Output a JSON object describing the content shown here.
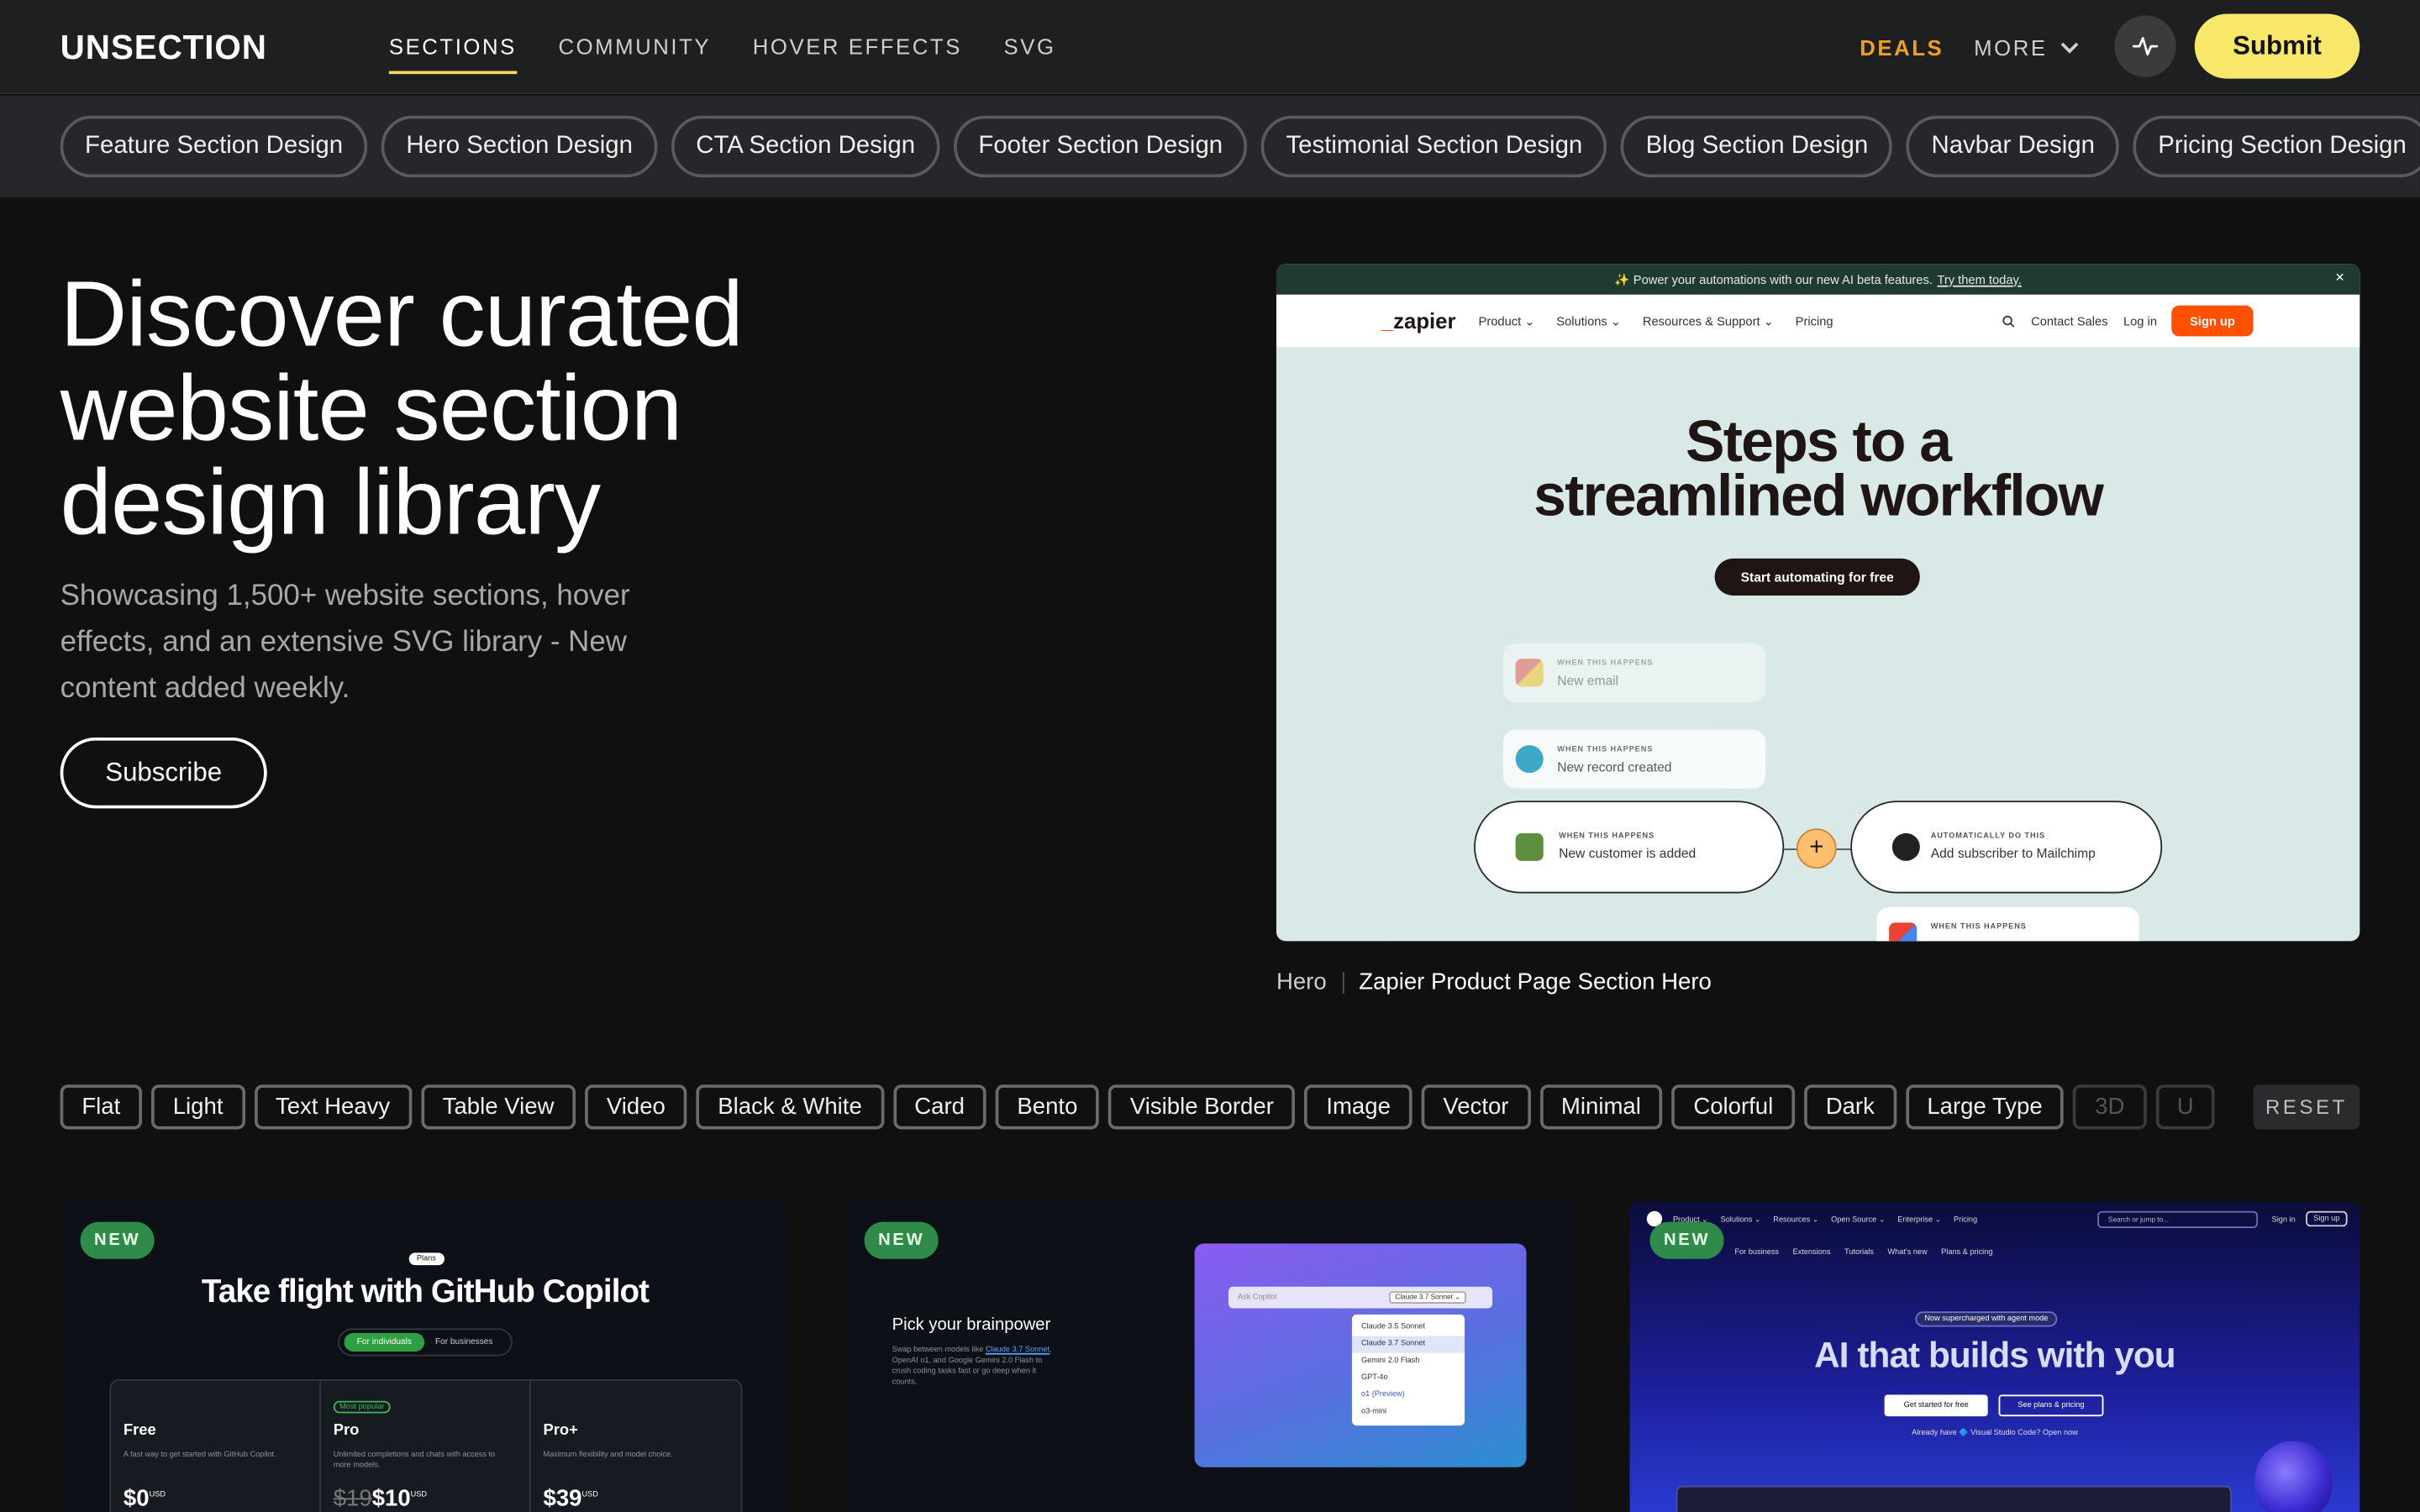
{
  "nav": {
    "logo": "UNSECTION",
    "links": [
      "SECTIONS",
      "COMMUNITY",
      "HOVER EFFECTS",
      "SVG"
    ],
    "deals": "DEALS",
    "more": "MORE",
    "submit": "Submit"
  },
  "categories": [
    "Feature Section Design",
    "Hero Section Design",
    "CTA Section Design",
    "Footer Section Design",
    "Testimonial Section Design",
    "Blog Section Design",
    "Navbar Design",
    "Pricing Section Design"
  ],
  "hero": {
    "title": "Discover curated website section design library",
    "subtitle": "Showcasing 1,500+ website sections, hover effects, and an extensive SVG library - New content added weekly.",
    "subscribe": "Subscribe"
  },
  "preview": {
    "banner": "✨ Power your automations with our new AI beta features.",
    "banner_link": "Try them today.",
    "close": "×",
    "logo_mark": "_",
    "logo": "zapier",
    "nav_links": [
      "Product ⌄",
      "Solutions ⌄",
      "Resources & Support ⌄",
      "Pricing"
    ],
    "contact": "Contact Sales",
    "login": "Log in",
    "signup": "Sign up",
    "heading_line1": "Steps to a",
    "heading_line2": "streamlined workflow",
    "cta": "Start automating for free",
    "cards": [
      {
        "k": "WHEN THIS HAPPENS",
        "v": "New email"
      },
      {
        "k": "WHEN THIS HAPPENS",
        "v": "New record created"
      },
      {
        "k": "WHEN THIS HAPPENS",
        "v": "New customer is added"
      },
      {
        "k": "AUTOMATICALLY DO THIS",
        "v": "Add subscriber to Mailchimp"
      },
      {
        "k": "WHEN THIS HAPPENS",
        "v": ""
      }
    ]
  },
  "caption": {
    "category": "Hero",
    "title": "Zapier Product Page Section Hero"
  },
  "filters": [
    "Flat",
    "Light",
    "Text Heavy",
    "Table View",
    "Video",
    "Black & White",
    "Card",
    "Bento",
    "Visible Border",
    "Image",
    "Vector",
    "Minimal",
    "Colorful",
    "Dark",
    "Large Type",
    "3D",
    "U"
  ],
  "reset": "RESET",
  "badge_new": "NEW",
  "thumb1": {
    "plans": "Plans",
    "heading": "Take flight with GitHub Copilot",
    "toggle_on": "For individuals",
    "toggle_off": "For businesses",
    "plans_list": [
      {
        "name": "Free",
        "desc": "A fast way to get started with GitHub Copilot.",
        "price": "$0",
        "old": "",
        "unit": "USD",
        "tag": ""
      },
      {
        "name": "Pro",
        "desc": "Unlimited completions and chats with access to more models.",
        "price": "$10",
        "old": "$19",
        "unit": "USD",
        "tag": "Most popular"
      },
      {
        "name": "Pro+",
        "desc": "Maximum flexibility and model choice.",
        "price": "$39",
        "old": "",
        "unit": "USD",
        "tag": ""
      }
    ]
  },
  "thumb2": {
    "label": "Pick your brainpower",
    "desc_a": "Swap between models like",
    "desc_link": "Claude 3.7 Sonnet",
    "desc_b": ", OpenAI o1, and Google Gemini 2.0 Flash to crush coding tasks fast or go deep when it counts.",
    "input_placeholder": "Ask Copilot",
    "selected_model": "Claude 3.7 Sonnet ⌄",
    "models": [
      "Claude 3.5 Sonnet",
      "Claude 3.7 Sonnet",
      "Gemini 2.0 Flash",
      "GPT-4o",
      "o1 (Preview)",
      "o3-mini"
    ]
  },
  "thumb3": {
    "links": [
      "Product ⌄",
      "Solutions ⌄",
      "Resources ⌄",
      "Open Source ⌄",
      "Enterprise ⌄",
      "Pricing"
    ],
    "search": "Search or jump to...",
    "signin": "Sign in",
    "signup": "Sign up",
    "sublinks": [
      "For business",
      "Extensions",
      "Tutorials",
      "What's new",
      "Plans & pricing"
    ],
    "chip": "Now supercharged with agent mode",
    "heading": "AI that builds with you",
    "btn1": "Get started for free",
    "btn2": "See plans & pricing",
    "already": "Already have 🔷 Visual Studio Code? Open now"
  }
}
